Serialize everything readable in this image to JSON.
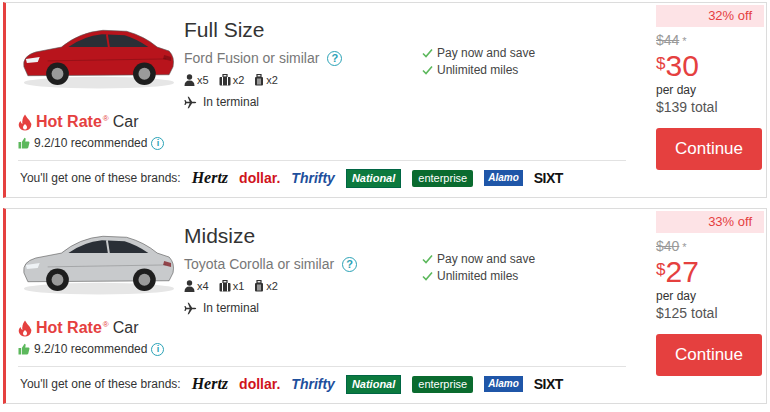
{
  "cars": [
    {
      "image_color": "#b8141c",
      "badge": "Hot Rate",
      "badge_mark": "®",
      "badge_suffix": "Car",
      "rating": "9.2/10 recommended",
      "rating_info": "i",
      "category": "Full Size",
      "model": "Ford Fusion or similar",
      "model_info": "?",
      "passengers": "x5",
      "bags_large": "x2",
      "bags_small": "x2",
      "location": "In terminal",
      "features": [
        "Pay now and save",
        "Unlimited miles"
      ],
      "discount": "32% off",
      "old_price": "$44",
      "old_price_mark": "*",
      "currency": "$",
      "price": "30",
      "price_unit": "per day",
      "total": "$139 total",
      "button": "Continue",
      "brands_label": "You'll get one of these brands:",
      "brands": [
        {
          "name": "Hertz",
          "kind": "hertz"
        },
        {
          "name": "dollar.",
          "kind": "dollar"
        },
        {
          "name": "Thrifty",
          "kind": "thrifty"
        },
        {
          "name": "National",
          "kind": "national"
        },
        {
          "name": "enterprise",
          "kind": "enterprise"
        },
        {
          "name": "Alamo",
          "kind": "alamo"
        },
        {
          "name": "SIXT",
          "kind": "sixt"
        }
      ]
    },
    {
      "image_color": "#c8cacc",
      "badge": "Hot Rate",
      "badge_mark": "®",
      "badge_suffix": "Car",
      "rating": "9.2/10 recommended",
      "rating_info": "i",
      "category": "Midsize",
      "model": "Toyota Corolla or similar",
      "model_info": "?",
      "passengers": "x4",
      "bags_large": "x1",
      "bags_small": "x2",
      "location": "In terminal",
      "features": [
        "Pay now and save",
        "Unlimited miles"
      ],
      "discount": "33% off",
      "old_price": "$40",
      "old_price_mark": "*",
      "currency": "$",
      "price": "27",
      "price_unit": "per day",
      "total": "$125 total",
      "button": "Continue",
      "brands_label": "You'll get one of these brands:",
      "brands": [
        {
          "name": "Hertz",
          "kind": "hertz"
        },
        {
          "name": "dollar.",
          "kind": "dollar"
        },
        {
          "name": "Thrifty",
          "kind": "thrifty"
        },
        {
          "name": "National",
          "kind": "national"
        },
        {
          "name": "enterprise",
          "kind": "enterprise"
        },
        {
          "name": "Alamo",
          "kind": "alamo"
        },
        {
          "name": "SIXT",
          "kind": "sixt"
        }
      ]
    }
  ]
}
